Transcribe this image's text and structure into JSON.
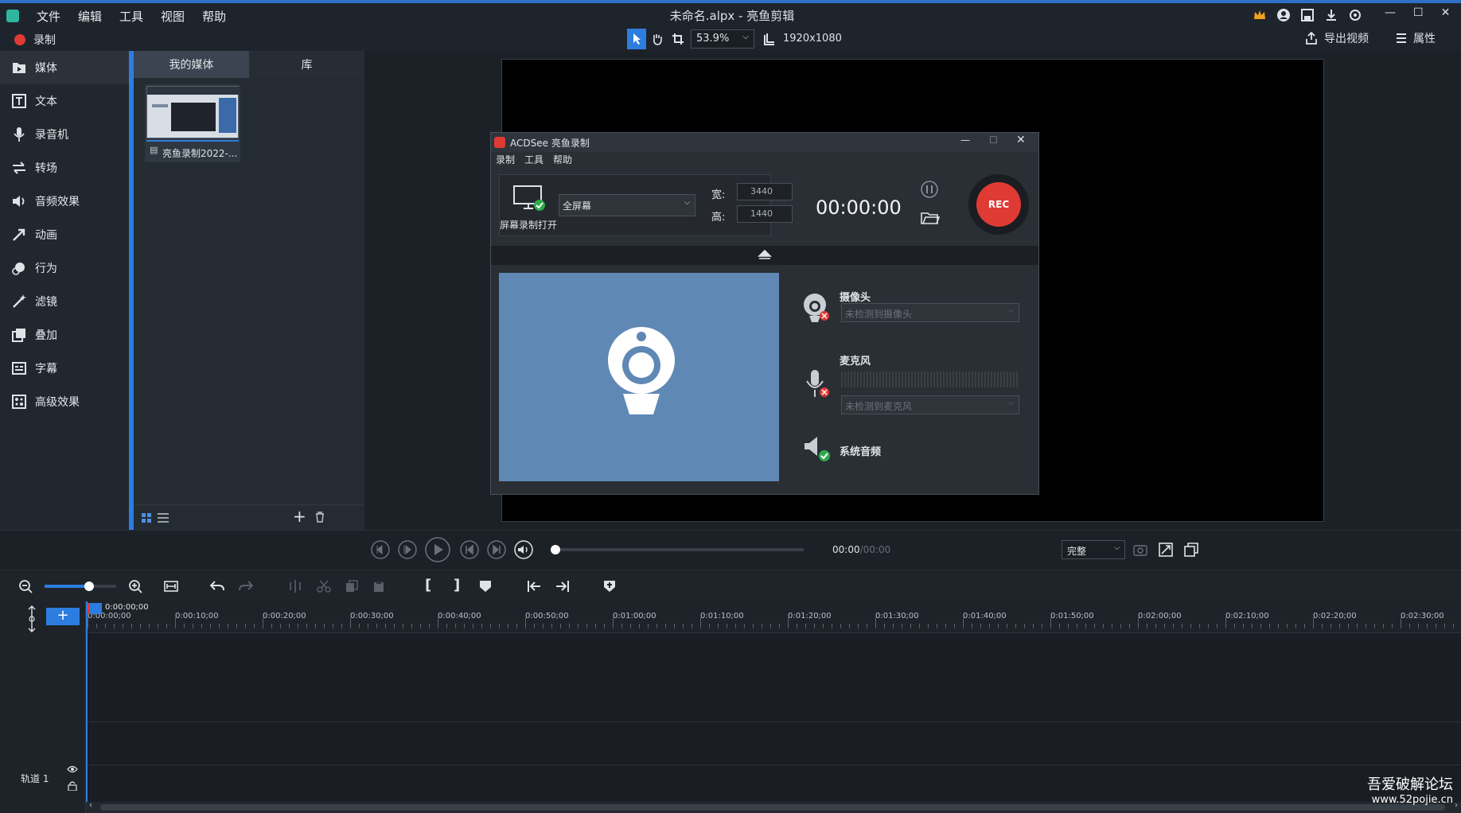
{
  "window": {
    "title": "未命名.alpx - 亮鱼剪辑",
    "menu": [
      "文件",
      "编辑",
      "工具",
      "视图",
      "帮助"
    ]
  },
  "toolbar": {
    "record_label": "录制",
    "zoom": "53.9%",
    "resolution": "1920x1080",
    "export_label": "导出视频",
    "properties_label": "属性"
  },
  "sidebar": {
    "items": [
      {
        "label": "媒体",
        "icon": "media-icon"
      },
      {
        "label": "文本",
        "icon": "text-icon"
      },
      {
        "label": "录音机",
        "icon": "microphone-icon"
      },
      {
        "label": "转场",
        "icon": "transition-icon"
      },
      {
        "label": "音频效果",
        "icon": "speaker-icon"
      },
      {
        "label": "动画",
        "icon": "arrow-icon"
      },
      {
        "label": "行为",
        "icon": "behavior-icon"
      },
      {
        "label": "滤镜",
        "icon": "wand-icon"
      },
      {
        "label": "叠加",
        "icon": "overlay-icon"
      },
      {
        "label": "字幕",
        "icon": "caption-icon"
      },
      {
        "label": "高级效果",
        "icon": "advanced-icon"
      }
    ]
  },
  "media": {
    "tabs": [
      "我的媒体",
      "库"
    ],
    "items": [
      {
        "name": "亮鱼录制2022-..."
      }
    ]
  },
  "recorder": {
    "title": "ACDSee 亮鱼录制",
    "menu": [
      "录制",
      "工具",
      "帮助"
    ],
    "mode": "全屏幕",
    "screen_label": "屏幕录制打开",
    "width_label": "宽:",
    "width": "3440",
    "height_label": "高:",
    "height": "1440",
    "timer": "00:00:00",
    "rec_label": "REC",
    "camera_label": "摄像头",
    "camera_placeholder": "未检测到摄像头",
    "mic_label": "麦克风",
    "mic_placeholder": "未检测到麦克风",
    "system_audio_label": "系统音频",
    "preview_color": "#5f88b5"
  },
  "transport": {
    "time_current": "00:00",
    "time_sep": "/",
    "time_total": "00:00",
    "quality": "完整"
  },
  "timeline": {
    "playhead": "0:00:00;00",
    "ticks": [
      "0:00:00;00",
      "0:00:10;00",
      "0:00:20;00",
      "0:00:30;00",
      "0:00:40;00",
      "0:00:50;00",
      "0:01:00;00",
      "0:01:10;00",
      "0:01:20;00",
      "0:01:30;00",
      "0:01:40;00",
      "0:01:50;00",
      "0:02:00;00",
      "0:02:10;00",
      "0:02:20;00",
      "0:02:30;00"
    ],
    "track_label": "轨道 1"
  },
  "watermark": {
    "line1": "吾爱破解论坛",
    "line2": "www.52pojie.cn"
  },
  "colors": {
    "accent": "#2d7de0",
    "rec": "#e03a35",
    "bg": "#1c2128"
  }
}
